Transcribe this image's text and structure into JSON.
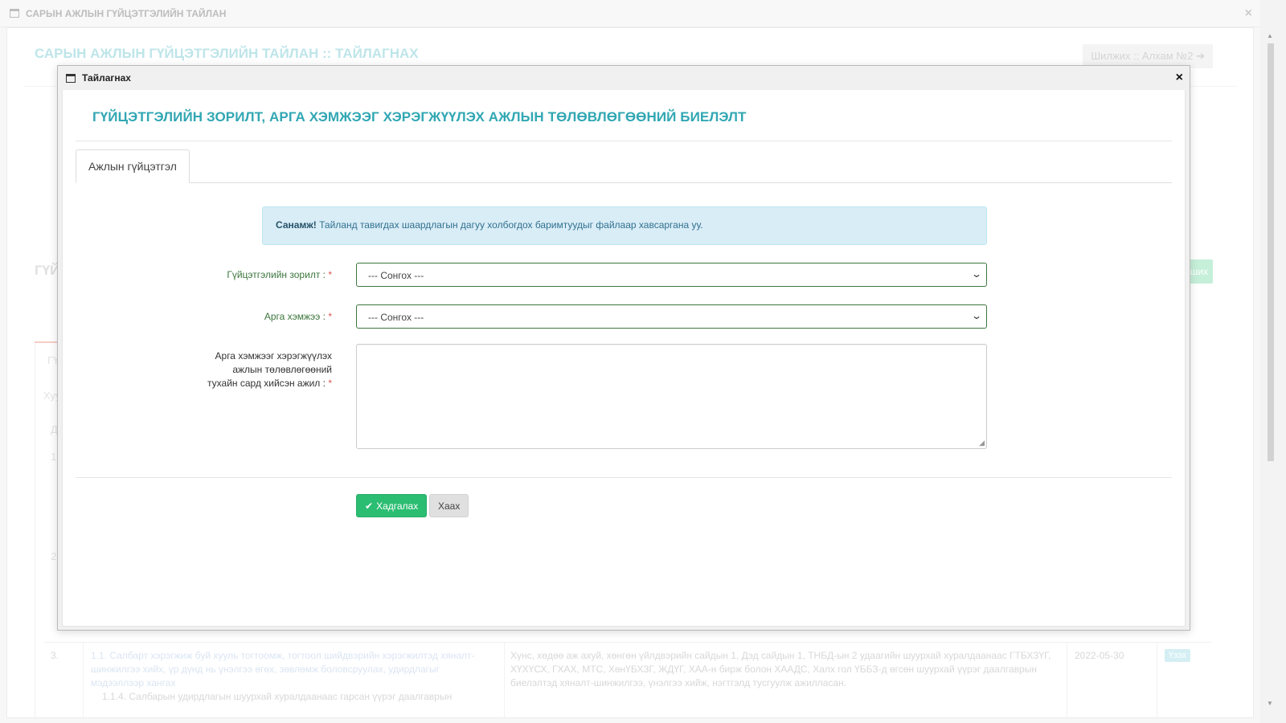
{
  "window": {
    "title": "САРЫН АЖЛЫН ГҮЙЦЭТГЭЛИЙН ТАЙЛАН",
    "close_glyph": "×"
  },
  "background": {
    "heading": "САРЫН АЖЛЫН ГҮЙЦЭТГЭЛИЙН ТАЙЛАН :: ТАЙЛАГНАХ",
    "step_button": "Шилжих :: Алхам №2 ➔",
    "section_heading_partial": "ГҮЙ",
    "green_button_partial": "ших",
    "tab_partial": "ГҮ",
    "sub_partial": "Хуу",
    "header_partial": "Д",
    "row1_num": "1.",
    "row2_num": "2.",
    "table_row": {
      "num": "3.",
      "task": "1.1. Салбарт хэрэгжиж буй хууль тогтоомж, тогтоол шийдвэрийн хэрэгжилтэд хяналт-шинжилгээ хийх, үр дүнд нь үнэлгээ өгөх, зөвлөмж боловсруулах, удирдлагыг мэдээллээр хангах",
      "subtask": "1.1.4. Салбарын удирдлагын шуурхай хуралдаанаас гарсан үүрэг даалгаврын",
      "work": "Хүнс, хөдөө аж ахуй, хөнгөн үйлдвэрийн сайдын 1, Дэд сайдын 1, ТНБД-ын 2 удаагийн шуурхай хуралдаанаас ГТБХЗҮГ, ХҮХҮСХ, ГХАХ, МТС, ХөнҮБХЗГ, ЖДҮГ, ХАА-н бирж болон ХААДС, Халх гол ҮББЗ-д өгсөн шуурхай үүрэг даалгаврын биелэлтэд хяналт-шинжилгээ, үнэлгээ хийж, нэгтгэлд тусгуулж ажилласан.",
      "date": "2022-05-30",
      "view_button": "Үзэх"
    }
  },
  "modal": {
    "title": "Тайлагнах",
    "close_glyph": "×",
    "heading": "ГҮЙЦЭТГЭЛИЙН ЗОРИЛТ, АРГА ХЭМЖЭЭГ ХЭРЭГЖҮҮЛЭХ АЖЛЫН ТӨЛӨВЛӨГӨӨНИЙ БИЕЛЭЛТ",
    "tabs": [
      {
        "label": "Ажлын гүйцэтгэл",
        "active": true
      }
    ],
    "alert": {
      "strong": "Санамж!",
      "text": " Тайланд тавигдах шаардлагын дагуу холбогдох баримтуудыг файлаар хавсаргана уу."
    },
    "fields": {
      "goal": {
        "label": "Гүйцэтгэлийн зорилт :",
        "required_mark": "*",
        "value": "--- Сонгох ---"
      },
      "measure": {
        "label": "Арга хэмжээ :",
        "required_mark": "*",
        "value": "--- Сонгох ---"
      },
      "work_done": {
        "label_line1": "Арга хэмжээг хэрэгжүүлэх",
        "label_line2": "ажлын төлөвлөгөөний",
        "label_line3": "тухайн сард хийсэн ажил :",
        "required_mark": "*",
        "value": ""
      }
    },
    "buttons": {
      "save": "Хадгалах",
      "close": "Хаах"
    }
  },
  "colors": {
    "accent_heading": "#31a7b3",
    "save_green": "#2bbd72",
    "alert_bg": "#d9edf7",
    "required_red": "#d9534f",
    "valid_green": "#3c763d"
  },
  "icons": [
    "window-icon",
    "close-icon",
    "chevron-down-icon",
    "check-icon",
    "resize-handle-icon"
  ]
}
